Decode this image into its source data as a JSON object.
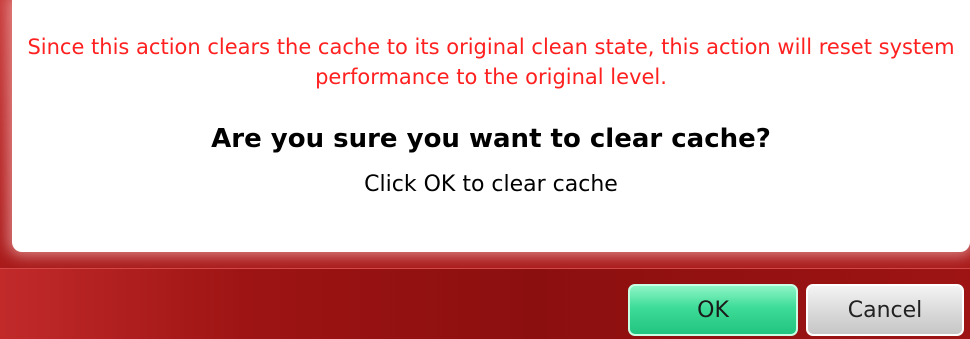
{
  "dialog": {
    "warning": "Since this action clears the cache to its original clean state, this action will reset system performance to the original level.",
    "question": "Are you sure you want to clear cache?",
    "instruction": "Click OK to clear cache"
  },
  "buttons": {
    "ok_label": "OK",
    "cancel_label": "Cancel"
  },
  "colors": {
    "warning_text": "#ff2020",
    "frame": "#b01c1c",
    "ok_button": "#3ddc98",
    "cancel_button": "#d9d9d9"
  }
}
